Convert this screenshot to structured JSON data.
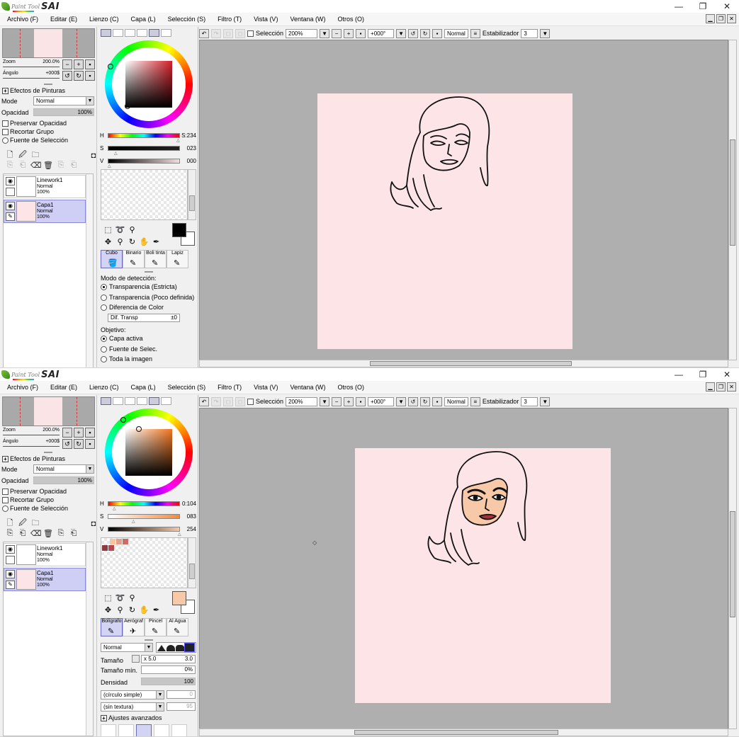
{
  "app": {
    "logo_small": "Paint Tool",
    "logo_big": "SAI"
  },
  "window_buttons": [
    "—",
    "❐",
    "✕"
  ],
  "menu": [
    "Archivo (F)",
    "Editar (E)",
    "Lienzo (C)",
    "Capa (L)",
    "Selección (S)",
    "Filtro (T)",
    "Vista (V)",
    "Ventana (W)",
    "Otros (O)"
  ],
  "navigator": {
    "zoom_label": "Zoom",
    "zoom_value": "200.0%",
    "angle_label": "Ángulo",
    "angle_value": "+000$"
  },
  "layer_props": {
    "effects_label": "Efectos de Pinturas",
    "mode_label": "Mode",
    "mode_value": "Normal",
    "opacity_label": "Opacidad",
    "opacity_value": "100%",
    "preserve_label": "Preservar Opacidad",
    "clip_label": "Recortar Grupo",
    "selection_source_label": "Fuente de Selección"
  },
  "layers": [
    {
      "name": "Linework1",
      "mode": "Normal",
      "opacity": "100%"
    },
    {
      "name": "Capa1",
      "mode": "Normal",
      "opacity": "100%"
    }
  ],
  "canvas_toolbar": {
    "selection_label": "Selección",
    "zoom": "200%",
    "angle": "+000°",
    "blend": "Normal",
    "stabilizer_label": "Estabilizador",
    "stabilizer_value": "3"
  },
  "window1": {
    "hsv": {
      "h_label": "H",
      "h_value": "S:234",
      "s_label": "S",
      "s_value": "023",
      "v_label": "V",
      "v_value": "000"
    },
    "primary_color": "#000000",
    "wheel_square_color": "#d4202a",
    "tool_tabs": [
      "Cubo",
      "Binario",
      "Boli tinta",
      "Lapiz"
    ],
    "options": {
      "detection_label": "Modo de detección:",
      "detection_options": [
        "Transparencia (Estricta)",
        "Transparencia (Poco definida)",
        "Diferencia de Color"
      ],
      "dif_label": "Dif. Transp",
      "dif_value": "±0",
      "target_label": "Objetivo:",
      "target_options": [
        "Capa activa",
        "Fuente de Selec.",
        "Toda la imagen"
      ]
    }
  },
  "window2": {
    "hsv": {
      "h_label": "H",
      "h_value": "0:104",
      "s_label": "S",
      "s_value": "083",
      "v_label": "V",
      "v_value": "254"
    },
    "primary_color": "#f7c9a8",
    "wheel_square_color": "#f0761e",
    "tool_tabs": [
      "Bolígrafo",
      "Aerógraf",
      "Pincel",
      "Al Agua"
    ],
    "swatch_colors": [
      "#f6c6a3",
      "#e3a08c",
      "#c96d69",
      "#8c3a3f",
      "#b24a52"
    ],
    "brush": {
      "mode_value": "Normal",
      "size_label": "Tamaño",
      "size_mult": "x 5.0",
      "size_value": "3.0",
      "min_size_label": "Tamaño mín.",
      "min_size_value": "0%",
      "density_label": "Densidad",
      "density_value": "100",
      "shape_value": "(círculo simple)",
      "shape_num": "0",
      "texture_value": "(sin textura)",
      "texture_num": "95",
      "advanced_label": "Ajustes avanzados"
    }
  },
  "colors": {
    "canvas_pink": "#fce4e7",
    "skin": "#f7c9a8",
    "lips": "#a8323c",
    "workspace": "#afafaf",
    "selected_layer": "#cfcff5"
  }
}
